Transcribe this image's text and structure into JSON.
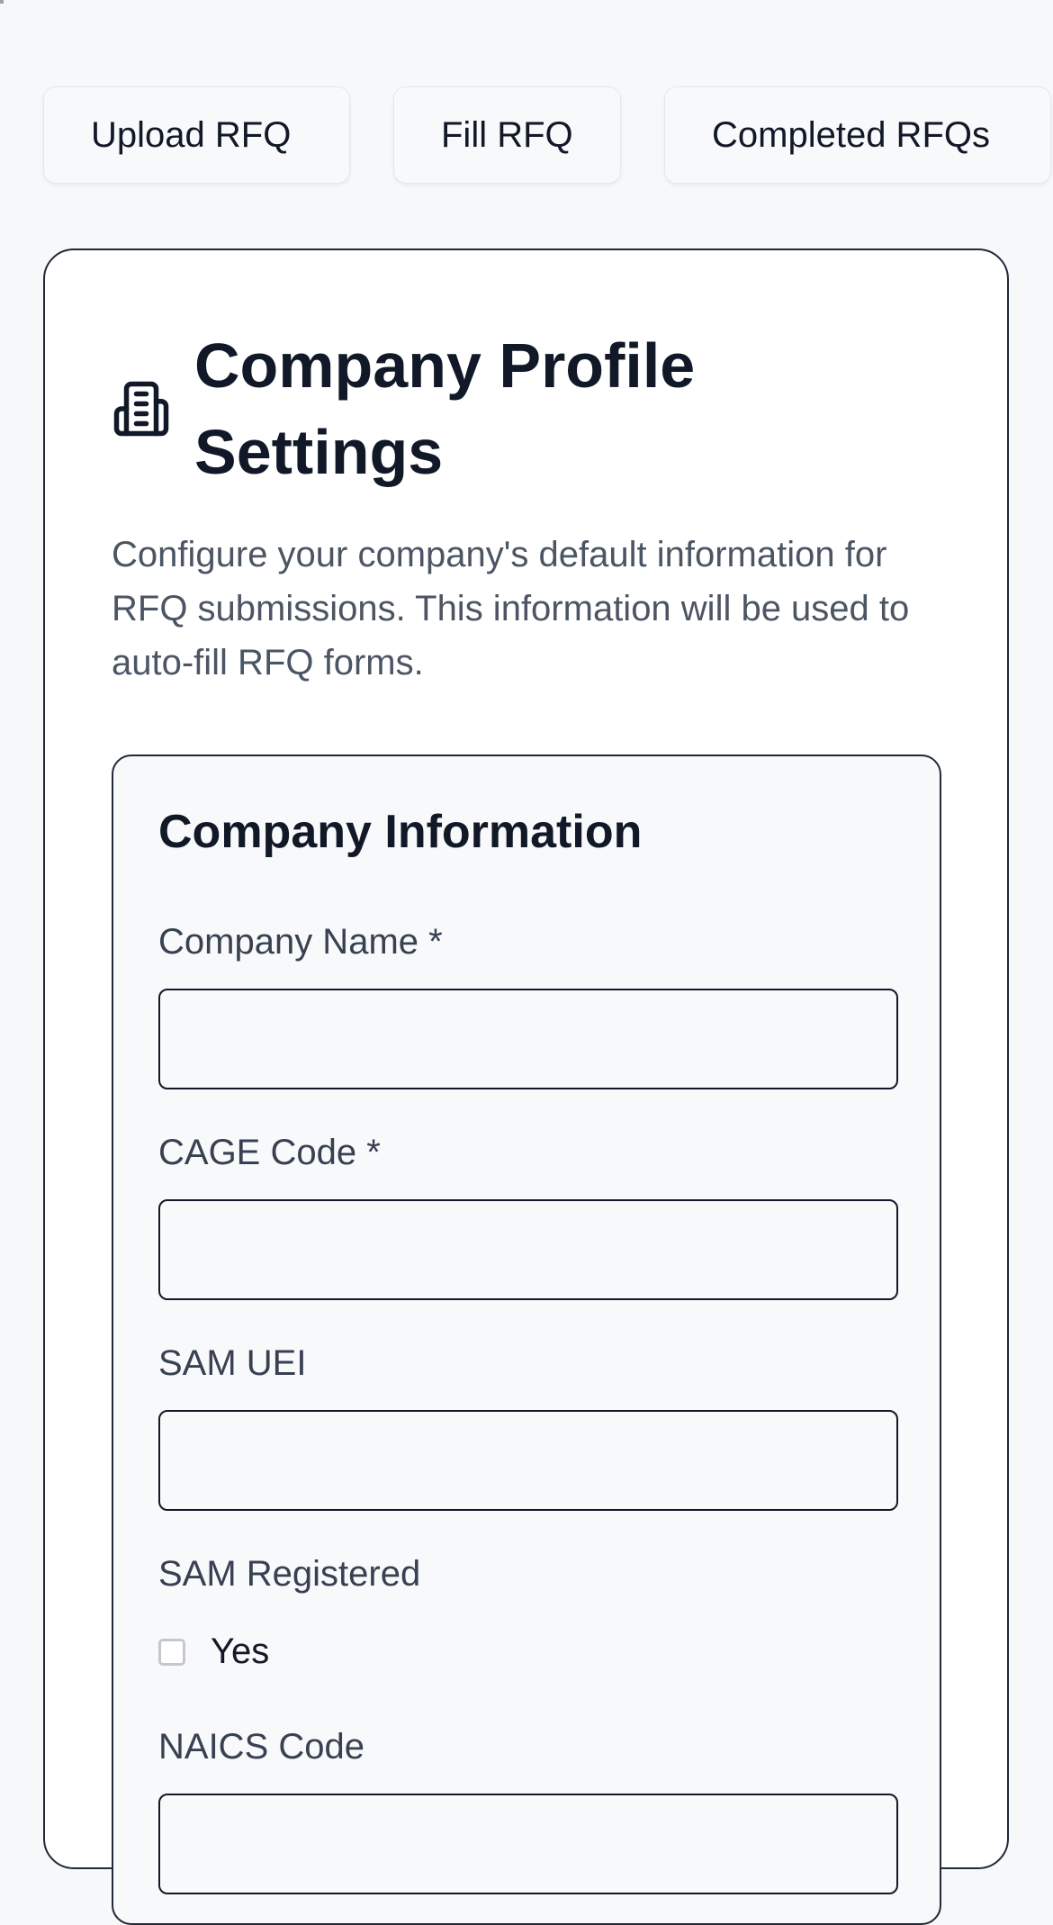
{
  "tabs": [
    {
      "label": "Upload RFQ"
    },
    {
      "label": "Fill RFQ"
    },
    {
      "label": "Completed RFQs"
    }
  ],
  "profile": {
    "icon": "building-icon",
    "title": "Company Profile Settings",
    "description": "Configure your company's default information for RFQ submissions. This information will be used to auto-fill RFQ forms."
  },
  "company_info": {
    "section_title": "Company Information",
    "company_name": {
      "label": "Company Name *",
      "value": ""
    },
    "cage_code": {
      "label": "CAGE Code *",
      "value": ""
    },
    "sam_uei": {
      "label": "SAM UEI",
      "value": ""
    },
    "sam_registered": {
      "label": "SAM Registered",
      "option_label": "Yes",
      "checked": false
    },
    "naics_code": {
      "label": "NAICS Code",
      "value": ""
    }
  }
}
